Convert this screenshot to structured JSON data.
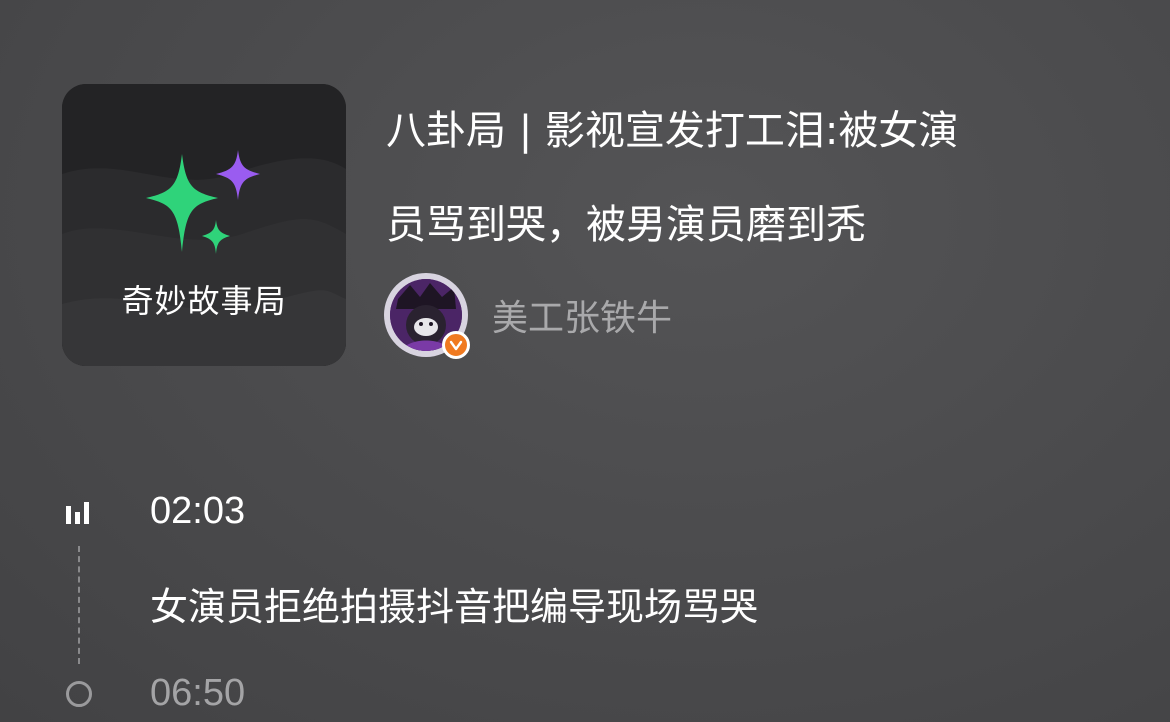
{
  "podcast": {
    "cover_title": "奇妙故事局",
    "colors": {
      "sparkle_green": "#2fd37a",
      "sparkle_purple": "#9a5cf0"
    }
  },
  "episode": {
    "title_line1": "八卦局 | 影视宣发打工泪:被女演",
    "title_line2": "员骂到哭，被男演员磨到秃"
  },
  "author": {
    "name": "美工张铁牛",
    "verified_badge_icon": "verified-check-icon",
    "badge_color": "#f07a20"
  },
  "timeline": {
    "items": [
      {
        "time": "02:03",
        "icon": "audio-playing-bars-icon",
        "description": "女演员拒绝拍摄抖音把编导现场骂哭"
      },
      {
        "time": "06:50",
        "icon": "circle-icon"
      }
    ]
  }
}
